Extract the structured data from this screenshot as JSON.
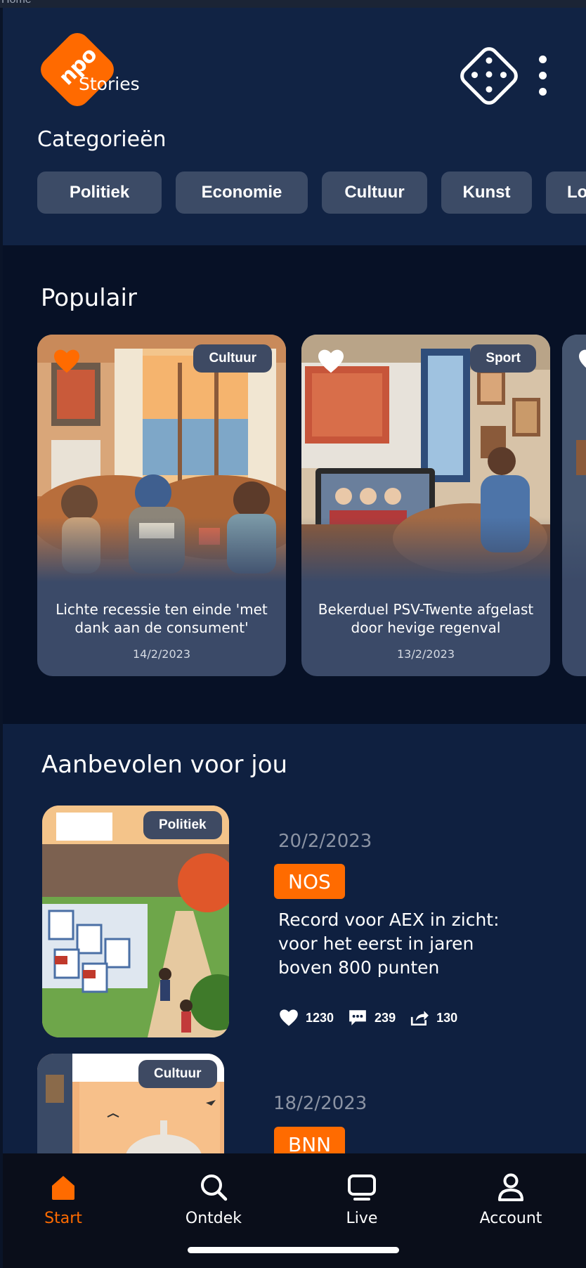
{
  "system": {
    "title_fragment": "Home"
  },
  "header": {
    "logo_text": "npo",
    "logo_subtitle": "Stories",
    "categories_title": "Categorieën",
    "categories": [
      "Politiek",
      "Economie",
      "Cultuur",
      "Kunst",
      "Lo"
    ]
  },
  "popular": {
    "title": "Populair",
    "cards": [
      {
        "tag": "Cultuur",
        "title": "Lichte recessie ten einde 'met dank aan de consument'",
        "date": "14/2/2023",
        "liked": true
      },
      {
        "tag": "Sport",
        "title": "Bekerduel PSV-Twente afgelast door hevige regenval",
        "date": "13/2/2023",
        "liked": false
      }
    ]
  },
  "recommended": {
    "title": "Aanbevolen voor jou",
    "items": [
      {
        "tag": "Politiek",
        "date": "20/2/2023",
        "source": "NOS",
        "headline": "Record voor AEX in zicht: voor het eerst in jaren boven 800 punten",
        "likes": "1230",
        "comments": "239",
        "shares": "130"
      },
      {
        "tag": "Cultuur",
        "date": "18/2/2023",
        "source": "BNN"
      }
    ]
  },
  "nav": {
    "items": [
      {
        "label": "Start",
        "icon": "home-icon",
        "active": true
      },
      {
        "label": "Ontdek",
        "icon": "search-icon",
        "active": false
      },
      {
        "label": "Live",
        "icon": "tv-icon",
        "active": false
      },
      {
        "label": "Account",
        "icon": "user-icon",
        "active": false
      }
    ]
  },
  "colors": {
    "accent": "#ff6b00",
    "header_bg": "#112344",
    "popular_bg": "#071126",
    "recommended_bg": "#0f2040",
    "card_bg": "#3b4a68",
    "chip_bg": "#3c4b66",
    "nav_bg": "#0a0e1a"
  }
}
